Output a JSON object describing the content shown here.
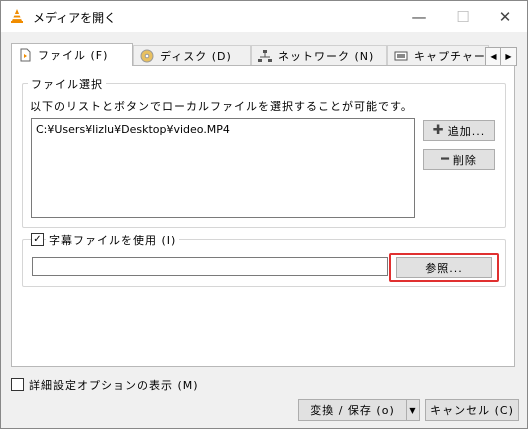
{
  "window": {
    "title": "メディアを開く",
    "min_glyph": "—",
    "max_glyph": "☐",
    "close_glyph": "✕"
  },
  "tabs": [
    {
      "label": "ファイル (F)",
      "icon": "file-icon",
      "active": true
    },
    {
      "label": "ディスク (D)",
      "icon": "disc-icon",
      "active": false
    },
    {
      "label": "ネットワーク (N)",
      "icon": "network-icon",
      "active": false
    },
    {
      "label": "キャプチャーデ",
      "icon": "capture-icon",
      "active": false
    }
  ],
  "tab_scroll": {
    "left": "◀",
    "right": "▶"
  },
  "file_selection": {
    "group_title": "ファイル選択",
    "description": "以下のリストとボタンでローカルファイルを選択することが可能です。",
    "files": [
      "C:¥Users¥lizlu¥Desktop¥video.MP4"
    ],
    "add_button": "追加...",
    "remove_button": "削除",
    "add_icon": "✚",
    "remove_icon": "━"
  },
  "subtitle": {
    "checkbox_label": "字幕ファイルを使用 (I)",
    "checked": true,
    "check_glyph": "✓",
    "path_value": "",
    "browse_button": "参照..."
  },
  "advanced": {
    "checkbox_label": "詳細設定オプションの表示 (M)",
    "checked": false
  },
  "footer": {
    "convert_button": "変換 / 保存 (o)",
    "dropdown_glyph": "▼",
    "cancel_button": "キャンセル (C)"
  },
  "colors": {
    "highlight": "#e03030",
    "vlc_orange": "#f08c00"
  }
}
